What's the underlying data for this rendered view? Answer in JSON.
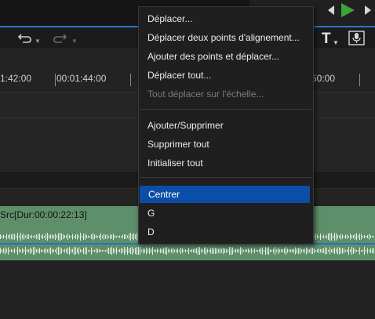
{
  "ruler": {
    "timecodes": [
      "1:42:00",
      "00:01:44:00",
      "50:00"
    ]
  },
  "clip": {
    "label": "Src[Dur:00:00:22:13]"
  },
  "menu": {
    "items": [
      {
        "label": "Déplacer...",
        "enabled": true
      },
      {
        "label": "Déplacer deux points d'alignement...",
        "enabled": true
      },
      {
        "label": "Ajouter des points et déplacer...",
        "enabled": true
      },
      {
        "label": "Déplacer tout...",
        "enabled": true
      },
      {
        "label": "Tout déplacer sur l'échelle...",
        "enabled": false
      },
      {
        "label": "Ajouter/Supprimer",
        "enabled": true
      },
      {
        "label": "Supprimer tout",
        "enabled": true
      },
      {
        "label": "Initialiser tout",
        "enabled": true
      },
      {
        "label": "Centrer",
        "enabled": true,
        "highlighted": true
      },
      {
        "label": "G",
        "enabled": true
      },
      {
        "label": "D",
        "enabled": true
      }
    ]
  },
  "toolbar": {
    "icons": [
      "undo-icon",
      "redo-icon",
      "text-title-icon",
      "voice-record-icon"
    ]
  },
  "transport": {
    "icons": [
      "previous-icon",
      "play-icon",
      "next-icon"
    ],
    "play_color": "#3aa53a"
  },
  "colors": {
    "accent": "#2b74c9",
    "menu_highlight": "#0b4ea8",
    "clip": "#5e8f6b"
  }
}
